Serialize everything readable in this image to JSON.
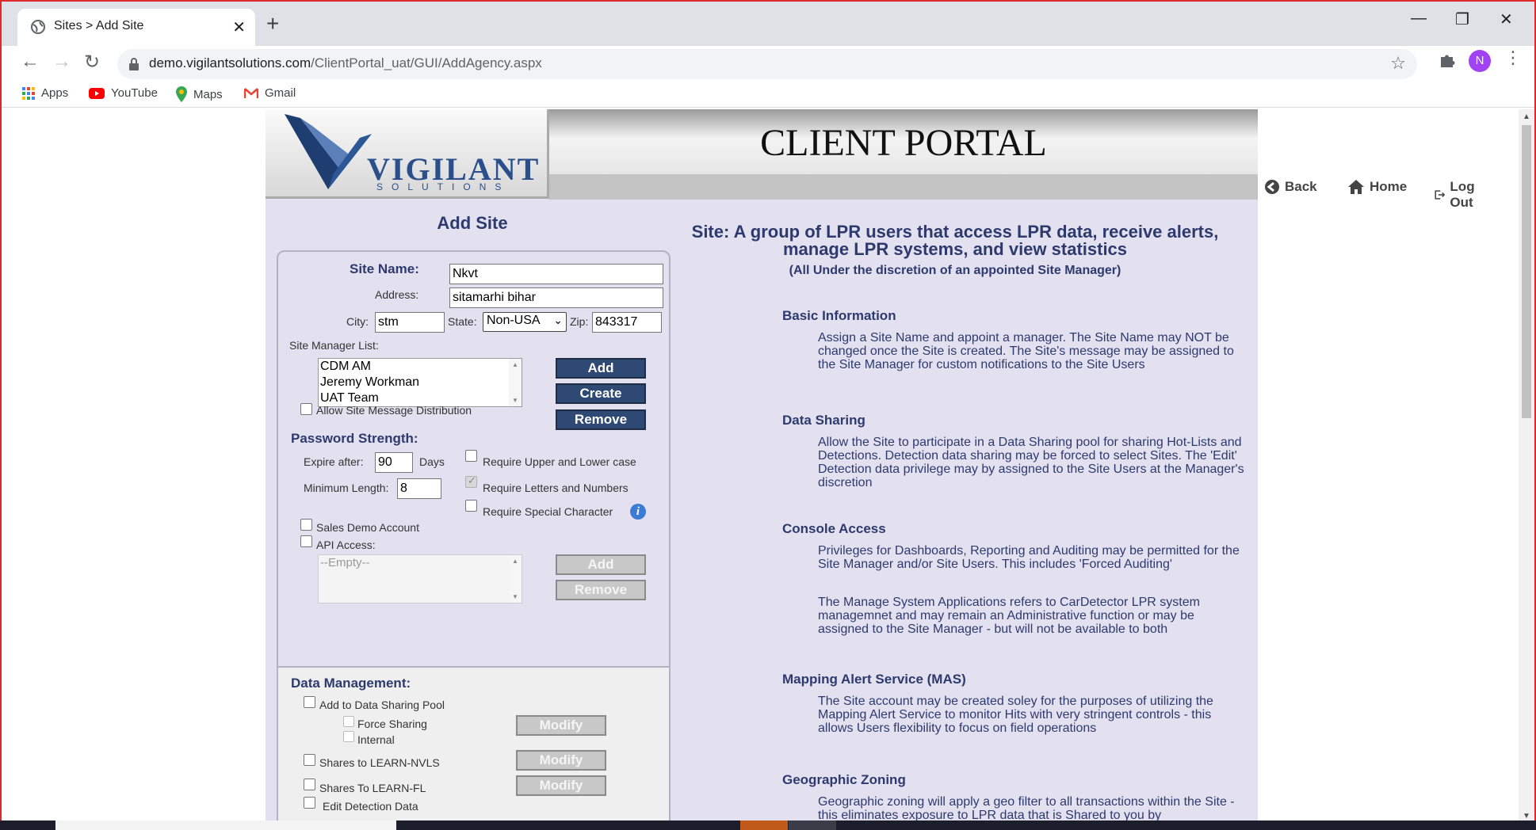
{
  "browser": {
    "tab_title": "Sites > Add Site",
    "tab_close": "✕",
    "new_tab": "+",
    "url_host": "demo.vigilantsolutions.com",
    "url_path": "/ClientPortal_uat/GUI/AddAgency.aspx",
    "avatar_letter": "N",
    "bookmarks": [
      "Apps",
      "YouTube",
      "Maps",
      "Gmail"
    ]
  },
  "header": {
    "logo_main": "VIGILANT",
    "logo_sub": "SOLUTIONS",
    "portal_title": "CLIENT PORTAL",
    "nav": {
      "back": "Back",
      "home": "Home",
      "logout": "Log Out"
    }
  },
  "form": {
    "title": "Add Site",
    "site_name_label": "Site Name:",
    "site_name_value": "Nkvt",
    "address_label": "Address:",
    "address_value": "sitamarhi bihar",
    "city_label": "City:",
    "city_value": "stm",
    "state_label": "State:",
    "state_value": "Non-USA",
    "zip_label": "Zip:",
    "zip_value": "843317",
    "manager_list_label": "Site Manager List:",
    "managers": [
      "CDM AM",
      "Jeremy Workman",
      "UAT Team"
    ],
    "btn_add": "Add",
    "btn_create": "Create",
    "btn_remove": "Remove",
    "allow_distribution": "Allow Site Message Distribution",
    "password_strength": "Password Strength:",
    "expire_label": "Expire after:",
    "expire_value": "90",
    "days_label": "Days",
    "min_len_label": "Minimum Length:",
    "min_len_value": "8",
    "req_upper_lower": "Require Upper and Lower case",
    "req_letters_numbers": "Require Letters and Numbers",
    "req_special": "Require Special Character",
    "sales_demo": "Sales Demo Account",
    "api_access": "API Access:",
    "api_empty": "--Empty--",
    "api_add": "Add",
    "api_remove": "Remove",
    "data_mgmt": "Data Management:",
    "add_pool": "Add to Data Sharing Pool",
    "force_sharing": "Force Sharing",
    "internal": "Internal",
    "modify": "Modify",
    "shares_nvls": "Shares to LEARN-NVLS",
    "shares_fl": "Shares To LEARN-FL",
    "edit_detection": "Edit Detection Data"
  },
  "description": {
    "headline": "Site: A group of LPR users that access LPR data, receive alerts, manage LPR systems, and view statistics",
    "subline": "(All Under the discretion of an appointed Site Manager)",
    "sections": [
      {
        "title": "Basic Information",
        "text": "Assign a Site Name and appoint a manager. The Site Name may NOT be changed once the Site is created. The Site's message may be assigned to the Site Manager for custom notifications to the Site Users"
      },
      {
        "title": "Data Sharing",
        "text": "Allow the Site to participate in a Data Sharing pool for sharing Hot-Lists and Detections. Detection data sharing may be forced to select Sites. The 'Edit' Detection data privilege may by assigned to the Site Users at the Manager's discretion"
      },
      {
        "title": "Console Access",
        "text": "Privileges for Dashboards, Reporting and Auditing may be permitted for the Site Manager and/or Site Users. This includes 'Forced Auditing'",
        "text2": "The Manage System Applications refers to CarDetector LPR system managemnet and may remain an Administrative function or may be assigned to the Site Manager - but will not be available to both"
      },
      {
        "title": "Mapping Alert Service (MAS)",
        "text": "The Site account may be created soley for the purposes of utilizing the Mapping Alert Service to monitor Hits with very stringent controls - this allows Users flexibility to focus on field operations"
      },
      {
        "title": "Geographic Zoning",
        "text": "Geographic zoning will apply a geo filter to all transactions within the Site - this eliminates exposure to LPR data that is Shared to you by"
      }
    ]
  },
  "colors": {
    "accent": "#2d3a6e",
    "button": "#2e4a74",
    "panel_bg": "#e3e1f0",
    "frame_border": "#e0282b"
  }
}
